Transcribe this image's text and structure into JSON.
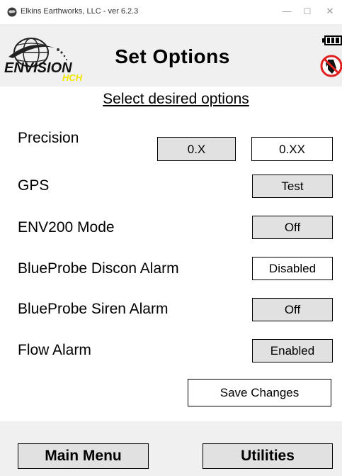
{
  "window": {
    "title": "Elkins Earthworks, LLC - ver 6.2.3",
    "minimize_glyph": "—",
    "maximize_glyph": "☐",
    "close_glyph": "✕"
  },
  "header": {
    "title": "Set Options",
    "logo_text": "ENVISION",
    "logo_subtext": "HCH",
    "icons": [
      "app-icon",
      "envision-logo",
      "battery-icon",
      "probe-disconnected-icon"
    ]
  },
  "subtitle": "Select desired options",
  "options": {
    "precision": {
      "label": "Precision",
      "buttons": [
        "0.X",
        "0.XX"
      ]
    },
    "gps": {
      "label": "GPS",
      "button": "Test"
    },
    "env200": {
      "label": "ENV200 Mode",
      "button": "Off"
    },
    "discon_alarm": {
      "label": "BlueProbe Discon Alarm",
      "button": "Disabled"
    },
    "siren_alarm": {
      "label": "BlueProbe Siren Alarm",
      "button": "Off"
    },
    "flow_alarm": {
      "label": "Flow Alarm",
      "button": "Enabled"
    }
  },
  "save_button": "Save Changes",
  "footer": {
    "main_menu": "Main Menu",
    "utilities": "Utilities"
  },
  "colors": {
    "header_bg": "#f0f0f0",
    "button_gray": "#e1e1e1",
    "button_white": "#ffffff",
    "logo_yellow": "#f2e600",
    "alert_red": "#e02020"
  }
}
